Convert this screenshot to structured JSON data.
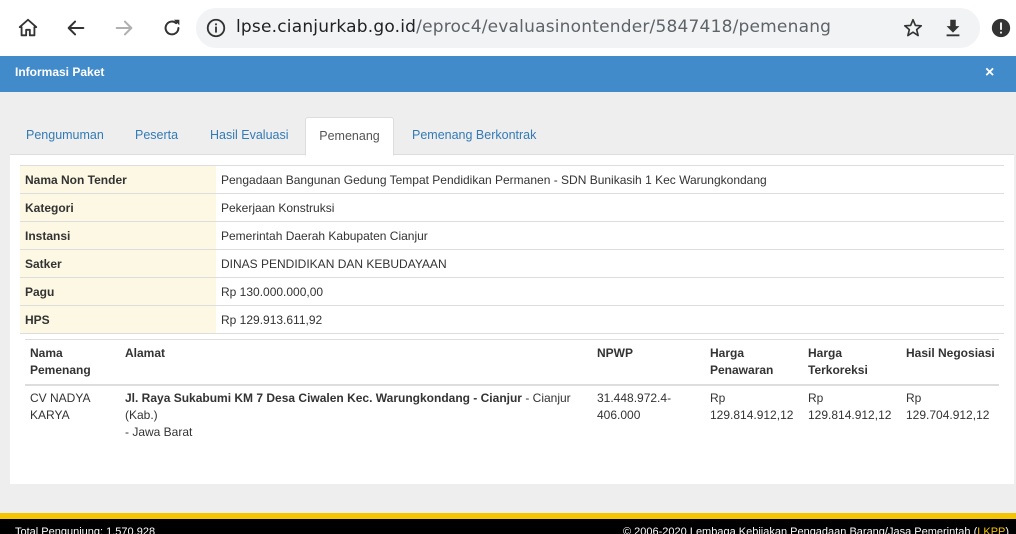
{
  "browser": {
    "url_host": "lpse.cianjurkab.go.id",
    "url_path": "/eproc4/evaluasinontender/5847418/pemenang",
    "icons": [
      "home-icon",
      "back-icon",
      "forward-icon",
      "reload-icon",
      "info-icon",
      "star-icon",
      "download-icon",
      "alert-icon"
    ]
  },
  "modal": {
    "title": "Informasi Paket",
    "close": "×"
  },
  "tabs": [
    {
      "label": "Pengumuman"
    },
    {
      "label": "Peserta"
    },
    {
      "label": "Hasil Evaluasi"
    },
    {
      "label": "Pemenang",
      "active": true
    },
    {
      "label": "Pemenang Berkontrak"
    }
  ],
  "info": [
    {
      "label": "Nama Non Tender",
      "value": "Pengadaan Bangunan Gedung Tempat Pendidikan Permanen - SDN Bunikasih 1 Kec Warungkondang"
    },
    {
      "label": "Kategori",
      "value": "Pekerjaan Konstruksi"
    },
    {
      "label": "Instansi",
      "value": "Pemerintah Daerah Kabupaten Cianjur"
    },
    {
      "label": "Satker",
      "value": "DINAS PENDIDIKAN DAN KEBUDAYAAN"
    },
    {
      "label": "Pagu",
      "value": "Rp 130.000.000,00"
    },
    {
      "label": "HPS",
      "value": "Rp 129.913.611,92"
    }
  ],
  "winner_table": {
    "headers": {
      "nama_1": "Nama",
      "nama_2": "Pemenang",
      "alamat": "Alamat",
      "npwp": "NPWP",
      "penawaran_1": "Harga",
      "penawaran_2": "Penawaran",
      "terkoreksi_1": "Harga",
      "terkoreksi_2": "Terkoreksi",
      "negosiasi": "Hasil Negosiasi"
    },
    "row": {
      "nama_1": "CV NADYA",
      "nama_2": "KARYA",
      "alamat_bold": "Jl. Raya Sukabumi KM 7 Desa Ciwalen Kec. Warungkondang - Cianjur",
      "alamat_rest_1": " - Cianjur (Kab.)",
      "alamat_rest_2": "- Jawa Barat",
      "npwp_1": "31.448.972.4-",
      "npwp_2": "406.000",
      "penawaran_1": "Rp",
      "penawaran_2": "129.814.912,12",
      "terkoreksi_1": "Rp",
      "terkoreksi_2": "129.814.912,12",
      "negosiasi_1": "Rp",
      "negosiasi_2": "129.704.912,12"
    }
  },
  "footer": {
    "left": "Total Pengunjung: 1.570.928",
    "right_text": "© 2006-2020 Lembaga Kebijakan Pengadaan Barang/Jasa Pemerintah (",
    "right_link": "LKPP",
    "right_end": ")"
  },
  "colors": {
    "header_blue": "#428bca",
    "label_bg": "#fcf8e3",
    "link_blue": "#337ab7",
    "footer_yellow": "#f5c400"
  }
}
